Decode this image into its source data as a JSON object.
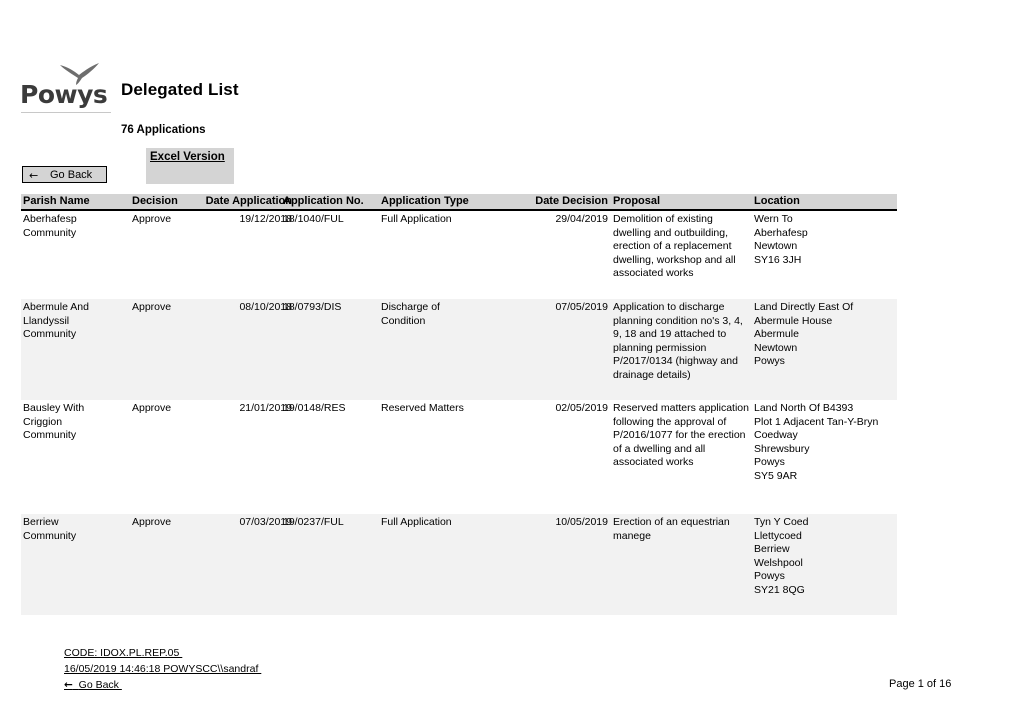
{
  "brand": {
    "logo_text": "Powys",
    "logo_icon": "red-kite-bird-icon",
    "logo_color": "#3b3b3b"
  },
  "header": {
    "title": "Delegated List",
    "applications_count": "76 Applications",
    "excel_link": "Excel Version",
    "go_back_label": "Go Back",
    "go_back_arrow": "←"
  },
  "table": {
    "columns": [
      "Parish Name",
      "Decision",
      "Date Application",
      "Application No.",
      "Application Type",
      "Date Decision",
      "Proposal",
      "Location"
    ],
    "rows": [
      {
        "parish": "Aberhafesp\nCommunity",
        "decision": "Approve",
        "date_application": "19/12/2018",
        "application_no": "18/1040/FUL",
        "application_type": "Full Application",
        "date_decision": "29/04/2019",
        "proposal": "Demolition of existing dwelling and outbuilding, erection of a replacement dwelling, workshop and all associated works",
        "location": "Wern To\nAberhafesp\nNewtown\nSY16 3JH"
      },
      {
        "parish": "Abermule And\nLlandyssil\nCommunity",
        "decision": "Approve",
        "date_application": "08/10/2018",
        "application_no": "18/0793/DIS",
        "application_type": "Discharge of\nCondition",
        "date_decision": "07/05/2019",
        "proposal": "Application to discharge planning condition no's 3, 4, 9, 18 and 19 attached to planning permission P/2017/0134 (highway and drainage details)",
        "location": "Land Directly East Of\nAbermule House\nAbermule\nNewtown\nPowys"
      },
      {
        "parish": "Bausley With\nCriggion\nCommunity",
        "decision": "Approve",
        "date_application": "21/01/2019",
        "application_no": "19/0148/RES",
        "application_type": "Reserved Matters",
        "date_decision": "02/05/2019",
        "proposal": "Reserved matters application following the approval of P/2016/1077 for the erection of a dwelling and all associated works",
        "location": "Land North Of B4393\nPlot 1 Adjacent Tan-Y-Bryn\nCoedway\nShrewsbury\nPowys\nSY5 9AR"
      },
      {
        "parish": "Berriew\nCommunity",
        "decision": "Approve",
        "date_application": "07/03/2019",
        "application_no": "19/0237/FUL",
        "application_type": "Full Application",
        "date_decision": "10/05/2019",
        "proposal": "Erection of an equestrian manege",
        "location": "Tyn Y Coed\nLlettycoed\nBerriew\nWelshpool\nPowys\nSY21 8QG"
      }
    ]
  },
  "footer": {
    "code_line": "CODE: IDOX.PL.REP.05 ",
    "timestamp_line": "16/05/2019 14:46:18 POWYSCC\\\\sandraf ",
    "go_back_arrow": "←",
    "go_back_label": "Go Back ",
    "page_number": "Page 1 of 16"
  },
  "colors": {
    "header_bar": "#d4d4d4",
    "alt_row": "#f2f2f2",
    "rule": "#000000"
  }
}
